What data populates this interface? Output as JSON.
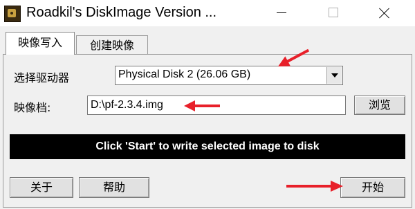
{
  "window": {
    "title": "Roadkil's DiskImage Version ...",
    "controls": [
      "minimize",
      "maximize",
      "close"
    ]
  },
  "tabs": [
    {
      "label": "映像写入",
      "active": true
    },
    {
      "label": "创建映像",
      "active": false
    }
  ],
  "form": {
    "drive_label": "选择驱动器",
    "drive_value": "Physical Disk 2 (26.06 GB)",
    "image_label": "映像档:",
    "image_value": "D:\\pf-2.3.4.img",
    "browse_label": "浏览"
  },
  "status": {
    "message": "Click 'Start' to write selected image to disk"
  },
  "buttons": {
    "about_label": "关于",
    "help_label": "帮助",
    "start_label": "开始"
  },
  "colors": {
    "annotation_arrow": "#e8202a",
    "status_background": "#000000",
    "status_text": "#ffffff"
  },
  "icons": [
    "app-icon",
    "minimize-icon",
    "maximize-icon",
    "close-icon",
    "dropdown-arrow-icon"
  ]
}
